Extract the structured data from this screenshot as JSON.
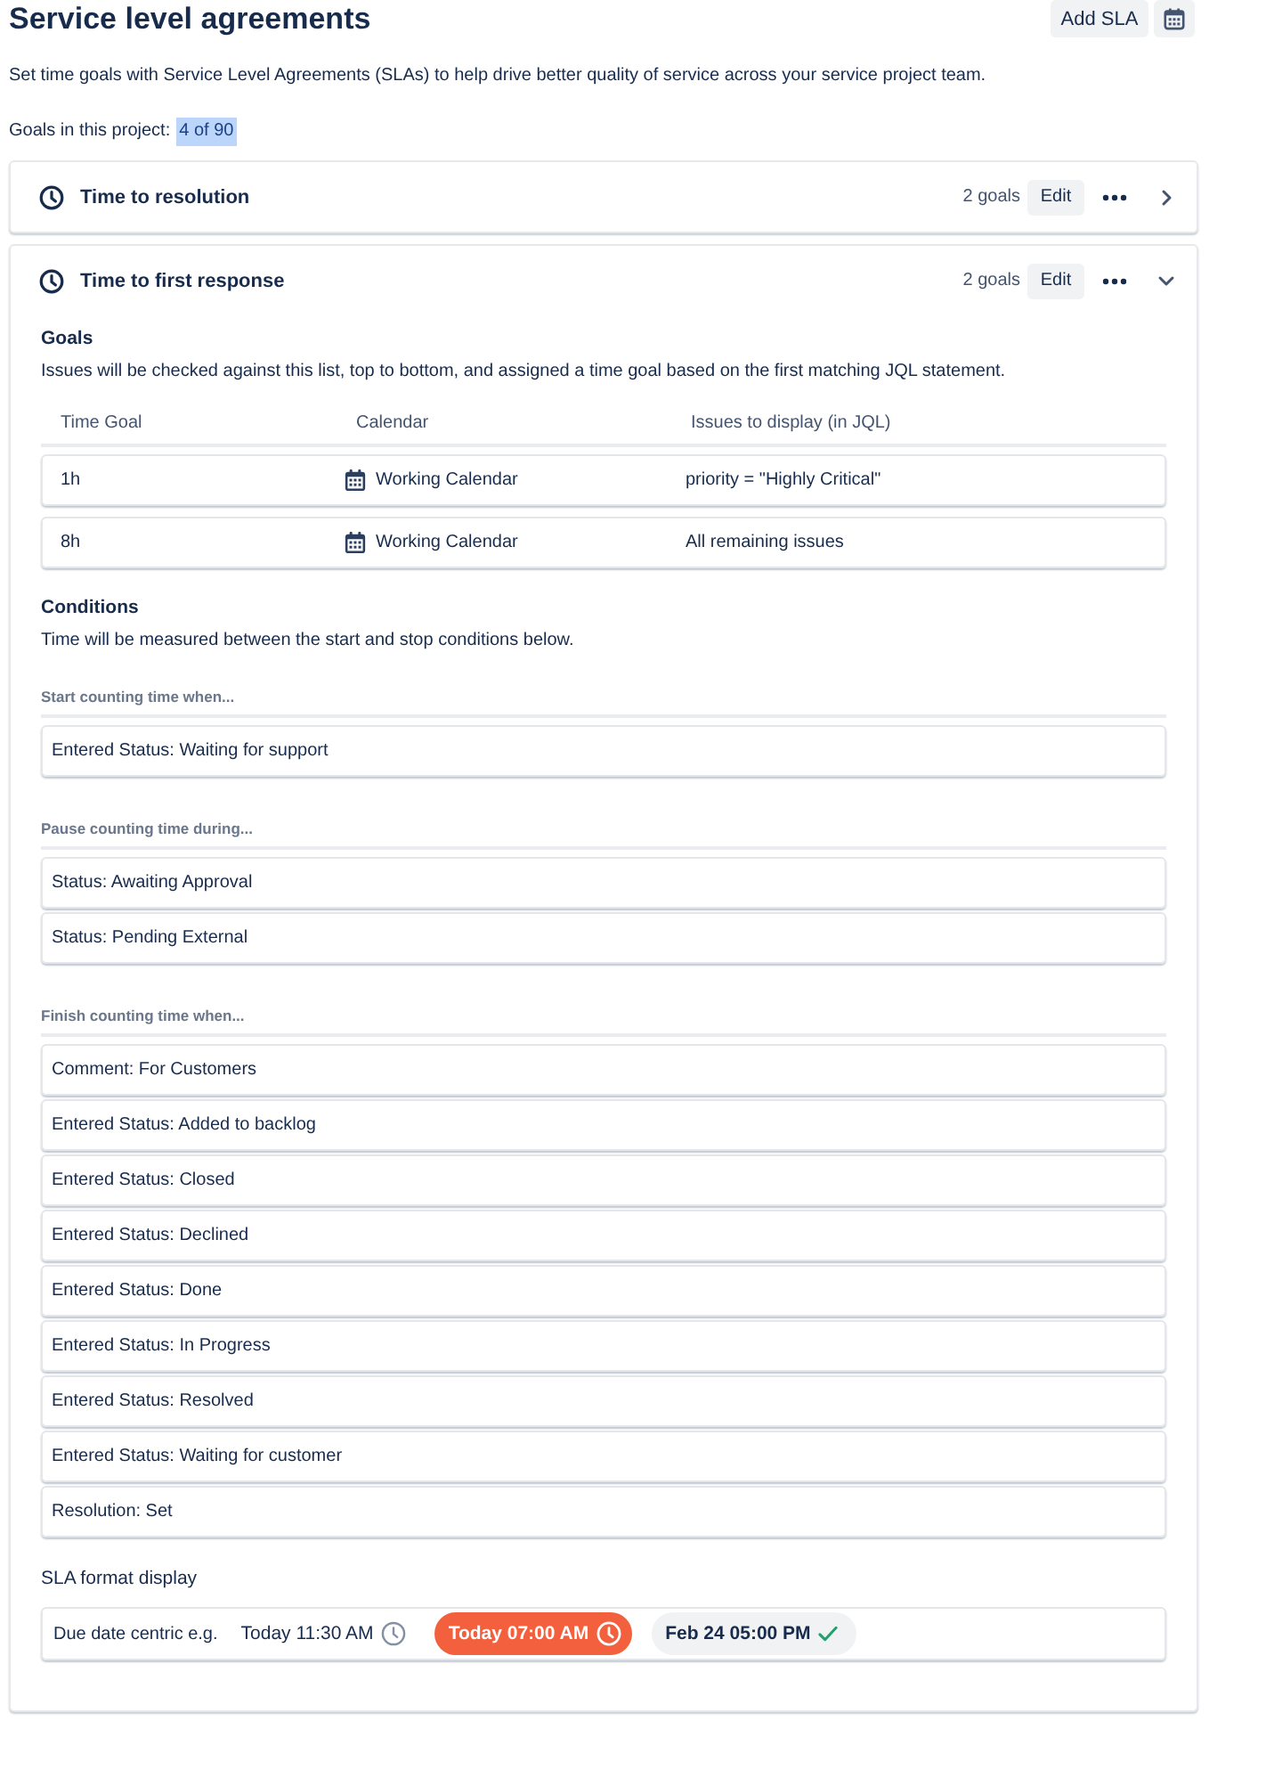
{
  "header": {
    "title": "Service level agreements",
    "add_button": "Add SLA"
  },
  "description": "Set time goals with Service Level Agreements (SLAs) to help drive better quality of service across your service project team.",
  "goals_summary": {
    "label": "Goals in this project:",
    "value": "4 of 90",
    "highlighted": true
  },
  "slas": [
    {
      "name": "Time to resolution",
      "goal_count": "2 goals",
      "edit": "Edit",
      "expanded": false
    },
    {
      "name": "Time to first response",
      "goal_count": "2 goals",
      "edit": "Edit",
      "expanded": true,
      "goals": {
        "heading": "Goals",
        "description": "Issues will be checked against this list, top to bottom, and assigned a time goal based on the first matching JQL statement.",
        "columns": [
          "Time Goal",
          "Calendar",
          "Issues to display (in JQL)"
        ],
        "rows": [
          {
            "time_goal": "1h",
            "calendar": "Working Calendar",
            "jql": "priority = \"Highly Critical\""
          },
          {
            "time_goal": "8h",
            "calendar": "Working Calendar",
            "jql": "All remaining issues"
          }
        ]
      },
      "conditions": {
        "heading": "Conditions",
        "description": "Time will be measured between the start and stop conditions below.",
        "groups": [
          {
            "label": "Start counting time when...",
            "items": [
              "Entered Status: Waiting for support"
            ]
          },
          {
            "label": "Pause counting time during...",
            "items": [
              "Status: Awaiting Approval",
              "Status: Pending External"
            ]
          },
          {
            "label": "Finish counting time when...",
            "items": [
              "Comment: For Customers",
              "Entered Status: Added to backlog",
              "Entered Status: Closed",
              "Entered Status: Declined",
              "Entered Status: Done",
              "Entered Status: In Progress",
              "Entered Status: Resolved",
              "Entered Status: Waiting for customer",
              "Resolution: Set"
            ]
          }
        ]
      },
      "format_display": {
        "heading": "SLA format display",
        "label": "Due date centric e.g.",
        "examples": [
          {
            "kind": "plain",
            "text": "Today 11:30 AM"
          },
          {
            "kind": "breached",
            "text": "Today 07:00 AM"
          },
          {
            "kind": "met",
            "text": "Feb 24 05:00 PM"
          }
        ]
      }
    }
  ]
}
